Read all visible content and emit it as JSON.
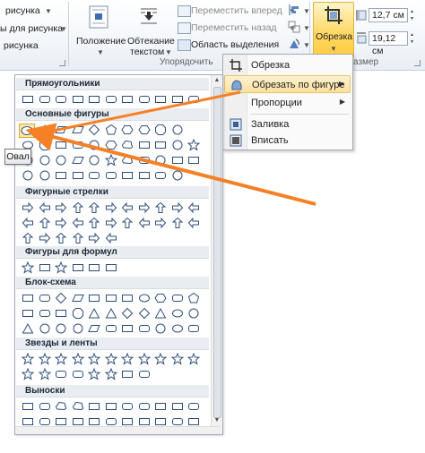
{
  "ribbon": {
    "left_items": {
      "picture_label": "рисунка",
      "picture_label2": "ы для рисунка",
      "picture_label3": "рисунка"
    },
    "position_label": "Положение",
    "wrap_label_1": "Обтекание",
    "wrap_label_2": "текстом",
    "bring_forward": "Переместить вперед",
    "send_backward": "Переместить назад",
    "selection_pane": "Область выделения",
    "arrange_group": "Упорядочить",
    "crop_label": "Обрезка",
    "size_group": "азмер",
    "height_value": "12,7 см",
    "width_value": "19,12 см"
  },
  "menu": {
    "items": [
      {
        "label": "Обрезка",
        "icon": "crop-icon",
        "arrow": false,
        "highlighted": false
      },
      {
        "label": "Обрезать по фигуре",
        "icon": "crop-shape-icon",
        "arrow": true,
        "highlighted": true
      },
      {
        "label": "Пропорции",
        "icon": "",
        "arrow": true,
        "highlighted": false
      },
      {
        "label": "Заливка",
        "icon": "fill-icon",
        "arrow": false,
        "highlighted": false
      },
      {
        "label": "Вписать",
        "icon": "fit-icon",
        "arrow": false,
        "highlighted": false
      }
    ],
    "arrow_glyph": "▶"
  },
  "gallery": {
    "categories": [
      "Прямоугольники",
      "Основные фигуры",
      "Фигурные стрелки",
      "Фигуры для формул",
      "Блок-схема",
      "Звезды и ленты",
      "Выноски"
    ],
    "hovered_shape": "oval-shape"
  },
  "tooltip": {
    "text": "Овал"
  },
  "colors": {
    "highlight": "#fbe19f",
    "annotation_arrow": "#f58025",
    "shape_stroke": "#2f4e7a"
  }
}
